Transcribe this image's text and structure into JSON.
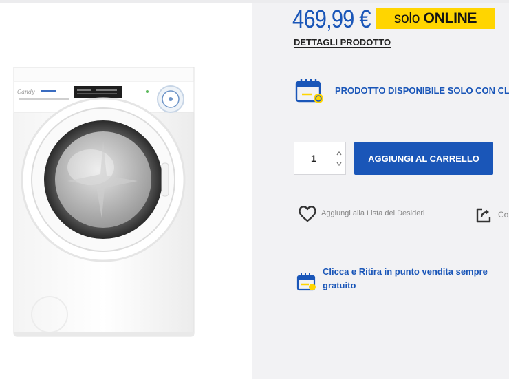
{
  "product": {
    "price": "469,99 €",
    "online_badge": {
      "light": "solo",
      "bold": "ONLINE"
    },
    "details_link": "DETTAGLI PRODOTTO",
    "online_only_notice": "PRODOTTO DISPONIBILE SOLO CON CL",
    "quantity": "1",
    "add_to_cart_label": "AGGIUNGI AL CARRELLO",
    "wishlist_label": "Aggiungi alla Lista dei Desideri",
    "share_label": "Co",
    "pickup_notice": "Clicca e Ritira in punto vendita sempre gratuito",
    "image": {
      "brand_logo": "Candy"
    }
  },
  "colors": {
    "accent_blue": "#1a56b8",
    "badge_yellow": "#ffd500",
    "right_panel_bg": "#f2f2f4"
  },
  "icons": [
    "calendar-online-icon",
    "chevron-up-icon",
    "chevron-down-icon",
    "heart-icon",
    "share-icon",
    "store-pickup-icon"
  ]
}
